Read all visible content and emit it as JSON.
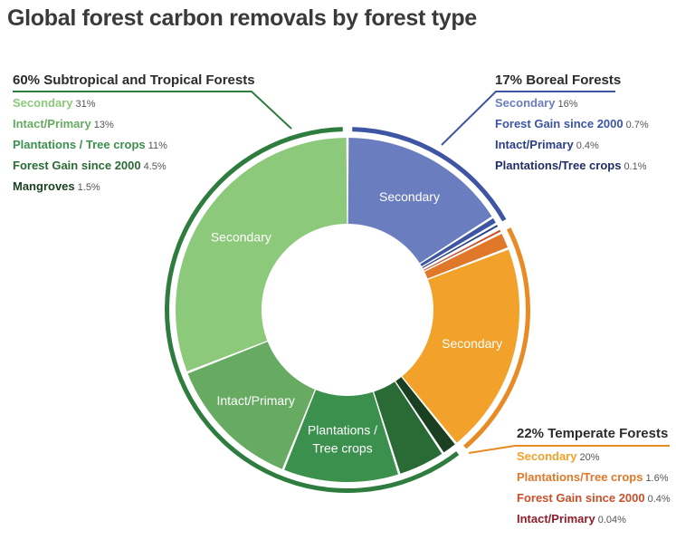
{
  "title": "Global forest carbon removals by forest type",
  "colors": {
    "subtropical_header": "#2e7d3e",
    "boreal_header": "#3d55a3",
    "temperate_header": "#e88b24"
  },
  "chart_data": {
    "type": "pie",
    "title": "Global forest carbon removals by forest type",
    "groups": [
      {
        "key": "boreal",
        "percent_label": "17%",
        "name": "Boreal Forests",
        "value": 17,
        "ring_color": "#3d55a3",
        "slices": [
          {
            "name": "Secondary",
            "value_label": "16%",
            "value": 16,
            "color": "#6a7dbf",
            "label_color": "#6a7dbf",
            "inner_label": "Secondary"
          },
          {
            "name": "Forest Gain since 2000",
            "value_label": "0.7%",
            "value": 0.7,
            "color": "#3d55a3",
            "label_color": "#3d55a3"
          },
          {
            "name": "Intact/Primary",
            "value_label": "0.4%",
            "value": 0.4,
            "color": "#2c3f86",
            "label_color": "#2c3f86"
          },
          {
            "name": "Plantations/Tree crops",
            "value_label": "0.1%",
            "value": 0.1,
            "color": "#1f2d66",
            "label_color": "#1f2d66"
          }
        ]
      },
      {
        "key": "temperate",
        "percent_label": "22%",
        "name": "Temperate Forests",
        "value": 22,
        "ring_color": "#e88b24",
        "slices": [
          {
            "name": "Intact/Primary",
            "value_label": "0.04%",
            "value": 0.04,
            "color": "#8b1e2a",
            "label_color": "#8b1e2a"
          },
          {
            "name": "Forest Gain since 2000",
            "value_label": "0.4%",
            "value": 0.4,
            "color": "#c7502a",
            "label_color": "#c7502a"
          },
          {
            "name": "Plantations/Tree crops",
            "value_label": "1.6%",
            "value": 1.6,
            "color": "#e0782a",
            "label_color": "#e0782a"
          },
          {
            "name": "Secondary",
            "value_label": "20%",
            "value": 20,
            "color": "#f2a12a",
            "label_color": "#f2a12a",
            "inner_label": "Secondary"
          }
        ]
      },
      {
        "key": "subtropical",
        "percent_label": "60%",
        "name": "Subtropical and Tropical Forests",
        "value": 60,
        "ring_color": "#2e7d3e",
        "slices": [
          {
            "name": "Mangroves",
            "value_label": "1.5%",
            "value": 1.5,
            "color": "#1b3f21",
            "label_color": "#1b3f21"
          },
          {
            "name": "Forest Gain since 2000",
            "value_label": "4.5%",
            "value": 4.5,
            "color": "#2a6a35",
            "label_color": "#2a6a35"
          },
          {
            "name": "Plantations / Tree crops",
            "value_label": "11%",
            "value": 11,
            "color": "#3a904c",
            "label_color": "#3a904c",
            "inner_label": "Plantations /\nTree crops"
          },
          {
            "name": "Intact/Primary",
            "value_label": "13%",
            "value": 13,
            "color": "#67ab62",
            "label_color": "#67ab62",
            "inner_label": "Intact/Primary"
          },
          {
            "name": "Secondary",
            "value_label": "31%",
            "value": 31,
            "color": "#8cc97b",
            "label_color": "#8cc97b",
            "inner_label": "Secondary"
          }
        ]
      }
    ],
    "legend_order": {
      "subtropical": [
        "Secondary",
        "Intact/Primary",
        "Plantations / Tree crops",
        "Forest Gain since 2000",
        "Mangroves"
      ],
      "boreal": [
        "Secondary",
        "Forest Gain since 2000",
        "Intact/Primary",
        "Plantations/Tree crops"
      ],
      "temperate": [
        "Secondary",
        "Plantations/Tree crops",
        "Forest Gain since 2000",
        "Intact/Primary"
      ]
    }
  }
}
